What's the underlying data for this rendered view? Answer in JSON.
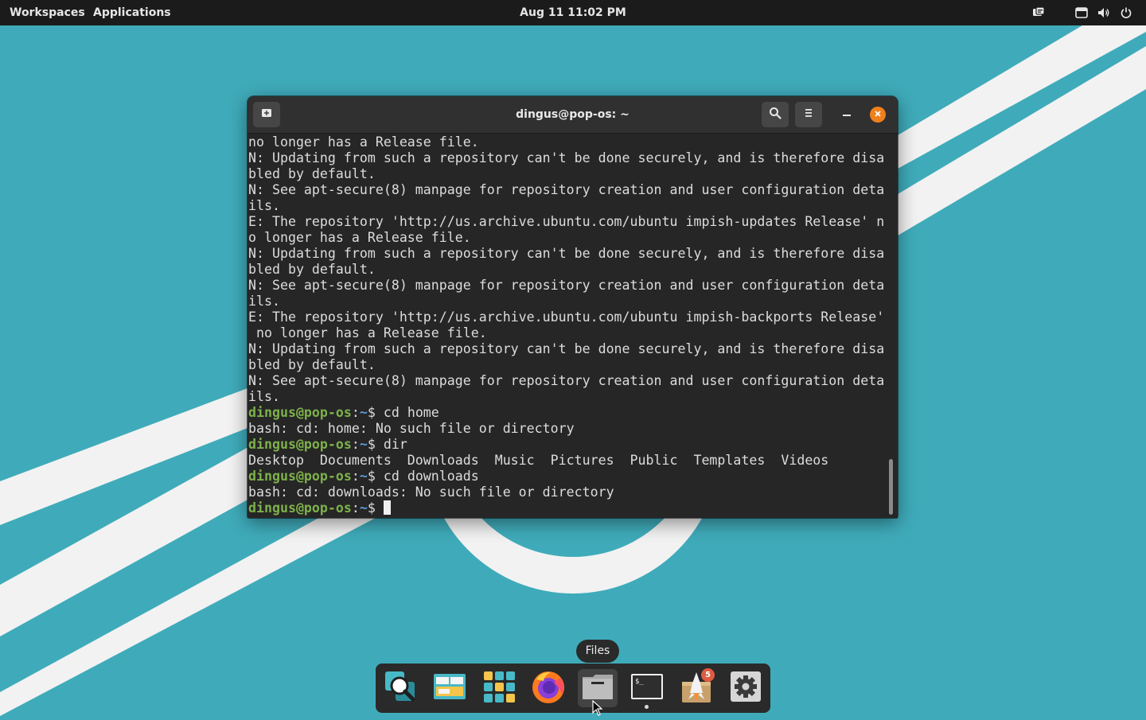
{
  "top_panel": {
    "workspaces_label": "Workspaces",
    "applications_label": "Applications",
    "clock": "Aug 11  11:02 PM",
    "tray_icons": [
      "notification-icon",
      "keyboard-icon",
      "volume-icon",
      "power-icon"
    ]
  },
  "terminal": {
    "title": "dingus@pop-os: ~",
    "header_buttons": [
      "new-tab-icon",
      "search-icon",
      "menu-icon",
      "minimize-icon",
      "close-icon"
    ],
    "prompt_user": "dingus@pop-os",
    "prompt_sep": ":",
    "prompt_path": "~",
    "prompt_symbol": "$ ",
    "lines": [
      {
        "type": "text",
        "text": "no longer has a Release file."
      },
      {
        "type": "text",
        "text": "N: Updating from such a repository can't be done securely, and is therefore disa"
      },
      {
        "type": "text",
        "text": "bled by default."
      },
      {
        "type": "text",
        "text": "N: See apt-secure(8) manpage for repository creation and user configuration deta"
      },
      {
        "type": "text",
        "text": "ils."
      },
      {
        "type": "text",
        "text": "E: The repository 'http://us.archive.ubuntu.com/ubuntu impish-updates Release' n"
      },
      {
        "type": "text",
        "text": "o longer has a Release file."
      },
      {
        "type": "text",
        "text": "N: Updating from such a repository can't be done securely, and is therefore disa"
      },
      {
        "type": "text",
        "text": "bled by default."
      },
      {
        "type": "text",
        "text": "N: See apt-secure(8) manpage for repository creation and user configuration deta"
      },
      {
        "type": "text",
        "text": "ils."
      },
      {
        "type": "text",
        "text": "E: The repository 'http://us.archive.ubuntu.com/ubuntu impish-backports Release'"
      },
      {
        "type": "text",
        "text": " no longer has a Release file."
      },
      {
        "type": "text",
        "text": "N: Updating from such a repository can't be done securely, and is therefore disa"
      },
      {
        "type": "text",
        "text": "bled by default."
      },
      {
        "type": "text",
        "text": "N: See apt-secure(8) manpage for repository creation and user configuration deta"
      },
      {
        "type": "text",
        "text": "ils."
      },
      {
        "type": "prompt",
        "text": "cd home"
      },
      {
        "type": "text",
        "text": "bash: cd: home: No such file or directory"
      },
      {
        "type": "prompt",
        "text": "dir"
      },
      {
        "type": "text",
        "text": "Desktop  Documents  Downloads  Music  Pictures  Public  Templates  Videos"
      },
      {
        "type": "prompt",
        "text": "cd downloads"
      },
      {
        "type": "text",
        "text": "bash: cd: downloads: No such file or directory"
      },
      {
        "type": "prompt",
        "text": "",
        "cursor": true
      }
    ]
  },
  "dock": {
    "items": [
      {
        "name": "search-app-icon",
        "label": "Search"
      },
      {
        "name": "workspaces-app-icon",
        "label": "Workspaces"
      },
      {
        "name": "applications-app-icon",
        "label": "Applications"
      },
      {
        "name": "firefox-app-icon",
        "label": "Firefox"
      },
      {
        "name": "files-app-icon",
        "label": "Files"
      },
      {
        "name": "terminal-app-icon",
        "label": "Terminal",
        "running": true
      },
      {
        "name": "pop-shop-app-icon",
        "label": "Pop!_Shop",
        "badge": "5"
      },
      {
        "name": "settings-app-icon",
        "label": "Settings"
      }
    ],
    "tooltip": "Files"
  },
  "colors": {
    "wallpaper": "#3fabba",
    "panel": "#1b1b1b",
    "terminal_bg": "#262626",
    "prompt_user": "#7db14a",
    "prompt_path": "#5e9ad8",
    "close_button": "#f0801c",
    "badge": "#e05b41"
  }
}
